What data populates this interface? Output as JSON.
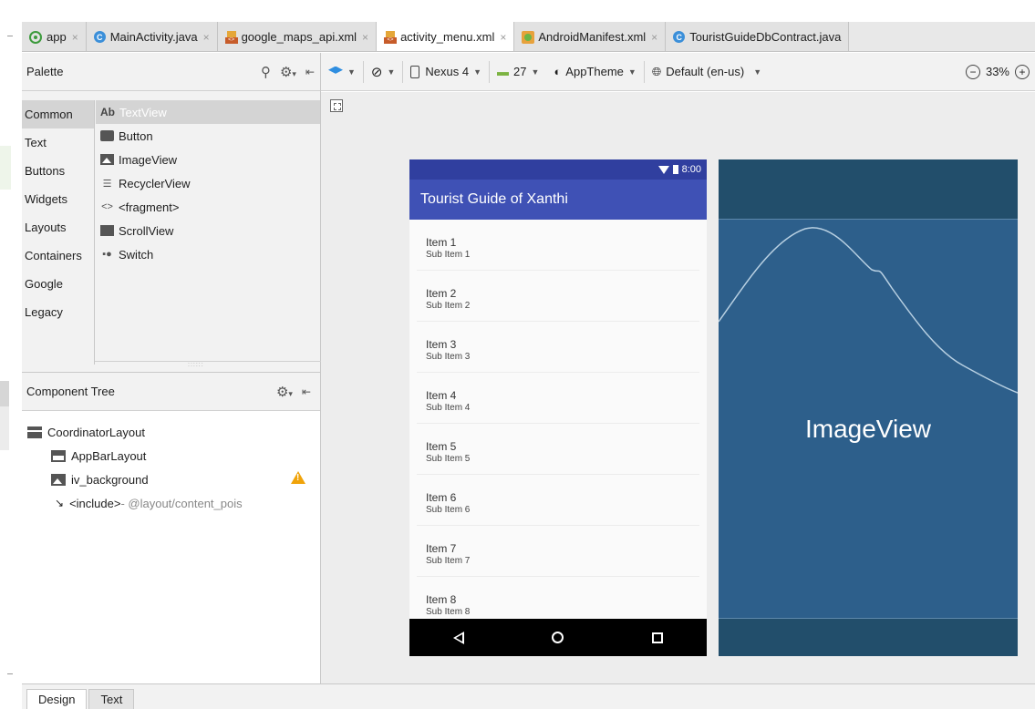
{
  "tabs": [
    {
      "label": "app",
      "icon": "app-module-icon",
      "active": false
    },
    {
      "label": "MainActivity.java",
      "icon": "class-icon",
      "active": false
    },
    {
      "label": "google_maps_api.xml",
      "icon": "xml-file-icon",
      "active": false
    },
    {
      "label": "activity_menu.xml",
      "icon": "xml-file-icon",
      "active": true
    },
    {
      "label": "AndroidManifest.xml",
      "icon": "manifest-icon",
      "active": false
    },
    {
      "label": "TouristGuideDbContract.java",
      "icon": "class-icon",
      "active": false
    }
  ],
  "palette": {
    "title": "Palette",
    "categories": [
      "Common",
      "Text",
      "Buttons",
      "Widgets",
      "Layouts",
      "Containers",
      "Google",
      "Legacy"
    ],
    "items": [
      {
        "icon_text": "Ab",
        "label": "TextView"
      },
      {
        "label": "Button"
      },
      {
        "label": "ImageView"
      },
      {
        "icon_text": "☰",
        "label": "RecyclerView"
      },
      {
        "icon_text": "<>",
        "label": "<fragment>"
      },
      {
        "label": "ScrollView"
      },
      {
        "icon_text": "▪●",
        "label": "Switch"
      }
    ]
  },
  "component_tree": {
    "title": "Component Tree",
    "nodes": [
      {
        "label": "CoordinatorLayout"
      },
      {
        "label": "AppBarLayout"
      },
      {
        "label": "iv_background"
      },
      {
        "label": "<include>",
        "detail": " - @layout/content_pois"
      }
    ]
  },
  "toolbar": {
    "device": "Nexus 4",
    "api": "27",
    "theme": "AppTheme",
    "locale": "Default (en-us)",
    "zoom": "33%",
    "zoom_out": "−",
    "zoom_in": "+"
  },
  "preview": {
    "status_time": "8:00",
    "app_title": "Tourist Guide of Xanthi",
    "rows": [
      {
        "title": "Item 1",
        "sub": "Sub Item 1"
      },
      {
        "title": "Item 2",
        "sub": "Sub Item 2"
      },
      {
        "title": "Item 3",
        "sub": "Sub Item 3"
      },
      {
        "title": "Item 4",
        "sub": "Sub Item 4"
      },
      {
        "title": "Item 5",
        "sub": "Sub Item 5"
      },
      {
        "title": "Item 6",
        "sub": "Sub Item 6"
      },
      {
        "title": "Item 7",
        "sub": "Sub Item 7"
      },
      {
        "title": "Item 8",
        "sub": "Sub Item 8"
      }
    ]
  },
  "blueprint": {
    "label": "ImageView"
  },
  "bottom_tabs": [
    {
      "label": "Design",
      "active": true
    },
    {
      "label": "Text",
      "active": false
    }
  ],
  "colors": {
    "primary": "#3f51b5",
    "primary_dark": "#303f9f",
    "blueprint": "#2d5f8b",
    "warning": "#f0a30a"
  }
}
